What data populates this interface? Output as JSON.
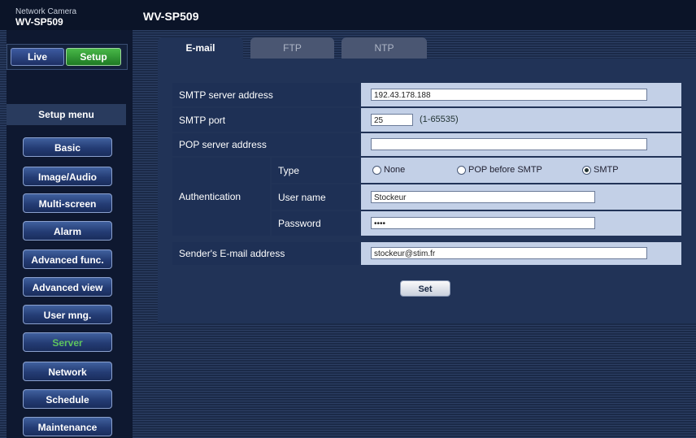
{
  "brand": {
    "line1": "Network Camera",
    "line2": "WV-SP509"
  },
  "page_title": "WV-SP509",
  "modes": {
    "live": "Live",
    "setup": "Setup"
  },
  "setup_menu": {
    "title": "Setup menu",
    "items": [
      {
        "label": "Basic"
      },
      {
        "label": "Image/Audio"
      },
      {
        "label": "Multi-screen"
      },
      {
        "label": "Alarm"
      },
      {
        "label": "Advanced func."
      },
      {
        "label": "Advanced view"
      },
      {
        "label": "User mng."
      },
      {
        "label": "Server"
      },
      {
        "label": "Network"
      },
      {
        "label": "Schedule"
      },
      {
        "label": "Maintenance"
      }
    ],
    "active": "Server"
  },
  "tabs": [
    {
      "label": "E-mail",
      "active": true
    },
    {
      "label": "FTP",
      "active": false
    },
    {
      "label": "NTP",
      "active": false
    }
  ],
  "form": {
    "smtp_server": {
      "label": "SMTP server address",
      "value": "192.43.178.188"
    },
    "smtp_port": {
      "label": "SMTP port",
      "value": "25",
      "range": "(1-65535)"
    },
    "pop_server": {
      "label": "POP server address",
      "value": ""
    },
    "authentication": {
      "label": "Authentication",
      "type_label": "Type",
      "options": [
        "None",
        "POP before SMTP",
        "SMTP"
      ],
      "selected": "SMTP",
      "user_label": "User name",
      "user_value": "Stockeur",
      "password_label": "Password",
      "password_value": "••••"
    },
    "sender": {
      "label": "Sender's E-mail address",
      "value": "stockeur@stim.fr"
    },
    "set_label": "Set"
  }
}
